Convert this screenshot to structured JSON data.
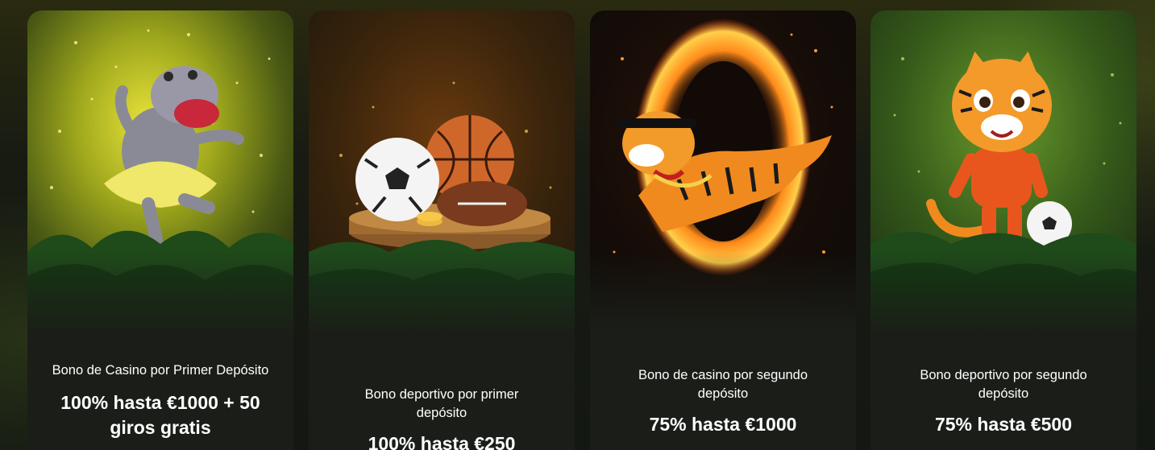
{
  "promotions": [
    {
      "title": "Bono de Casino por Primer Depósito",
      "amount": "100% hasta €1000 + 50 giros gratis",
      "illustration": "hippo-dancing-icon",
      "accent": "#d6d62a"
    },
    {
      "title": "Bono deportivo por primer depósito",
      "amount": "100% hasta €250",
      "illustration": "sports-balls-icon",
      "accent": "#c8812c"
    },
    {
      "title": "Bono de casino por segundo depósito",
      "amount": "75% hasta €1000",
      "illustration": "tiger-fire-ring-icon",
      "accent": "#f2641a"
    },
    {
      "title": "Bono deportivo por segundo depósito",
      "amount": "75% hasta €500",
      "illustration": "tiger-footballer-icon",
      "accent": "#6fae2a"
    }
  ]
}
